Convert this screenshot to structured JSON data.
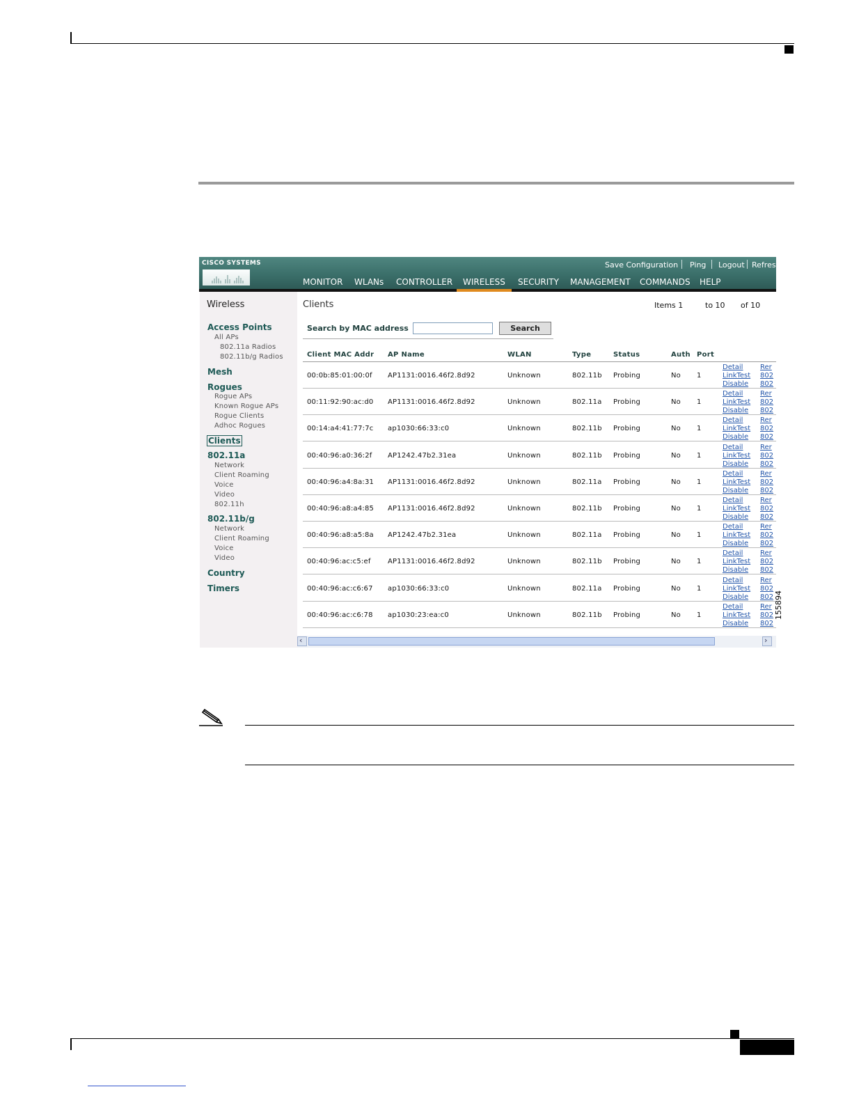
{
  "figure_number": "155894",
  "app": {
    "logo_text": "Cisco Systems",
    "top_links": [
      "Save Configuration",
      "Ping",
      "Logout",
      "Refres"
    ],
    "nav": [
      "MONITOR",
      "WLANs",
      "CONTROLLER",
      "WIRELESS",
      "SECURITY",
      "MANAGEMENT",
      "COMMANDS",
      "HELP"
    ],
    "nav_active": "WIRELESS",
    "accent_color": "#e08a1e",
    "banner_color": "#3b6f6a"
  },
  "sidebar": {
    "title": "Wireless",
    "access_points": "Access Points",
    "all_aps": "All APs",
    "radios_a": "802.11a Radios",
    "radios_bg": "802.11b/g Radios",
    "mesh": "Mesh",
    "rogues": "Rogues",
    "rogue_aps": "Rogue APs",
    "known_rogue_aps": "Known Rogue APs",
    "rogue_clients": "Rogue Clients",
    "adhoc_rogues": "Adhoc Rogues",
    "clients": "Clients",
    "a_head": "802.11a",
    "a_network": "Network",
    "a_roaming": "Client Roaming",
    "a_voice": "Voice",
    "a_video": "Video",
    "a_h": "802.11h",
    "bg_head": "802.11b/g",
    "bg_network": "Network",
    "bg_roaming": "Client Roaming",
    "bg_voice": "Voice",
    "bg_video": "Video",
    "country": "Country",
    "timers": "Timers"
  },
  "main": {
    "title": "Clients",
    "items_label": "Items 1",
    "to_label": "to 10",
    "of_label": "of 10",
    "search_label": "Search by MAC address",
    "search_value": "",
    "search_button": "Search"
  },
  "table": {
    "headers": [
      "Client MAC Addr",
      "AP Name",
      "WLAN",
      "Type",
      "Status",
      "Auth",
      "Port"
    ],
    "links": [
      "Detail",
      "LinkTest",
      "Disable"
    ],
    "links2": [
      "Rer",
      "802",
      "802"
    ],
    "rows": [
      [
        "00:0b:85:01:00:0f",
        "AP1131:0016.46f2.8d92",
        "Unknown",
        "802.11b",
        "Probing",
        "No",
        "1"
      ],
      [
        "00:11:92:90:ac:d0",
        "AP1131:0016.46f2.8d92",
        "Unknown",
        "802.11a",
        "Probing",
        "No",
        "1"
      ],
      [
        "00:14:a4:41:77:7c",
        "ap1030:66:33:c0",
        "Unknown",
        "802.11b",
        "Probing",
        "No",
        "1"
      ],
      [
        "00:40:96:a0:36:2f",
        "AP1242.47b2.31ea",
        "Unknown",
        "802.11b",
        "Probing",
        "No",
        "1"
      ],
      [
        "00:40:96:a4:8a:31",
        "AP1131:0016.46f2.8d92",
        "Unknown",
        "802.11a",
        "Probing",
        "No",
        "1"
      ],
      [
        "00:40:96:a8:a4:85",
        "AP1131:0016.46f2.8d92",
        "Unknown",
        "802.11b",
        "Probing",
        "No",
        "1"
      ],
      [
        "00:40:96:a8:a5:8a",
        "AP1242.47b2.31ea",
        "Unknown",
        "802.11a",
        "Probing",
        "No",
        "1"
      ],
      [
        "00:40:96:ac:c5:ef",
        "AP1131:0016.46f2.8d92",
        "Unknown",
        "802.11b",
        "Probing",
        "No",
        "1"
      ],
      [
        "00:40:96:ac:c6:67",
        "ap1030:66:33:c0",
        "Unknown",
        "802.11a",
        "Probing",
        "No",
        "1"
      ],
      [
        "00:40:96:ac:c6:78",
        "ap1030:23:ea:c0",
        "Unknown",
        "802.11b",
        "Probing",
        "No",
        "1"
      ]
    ]
  }
}
